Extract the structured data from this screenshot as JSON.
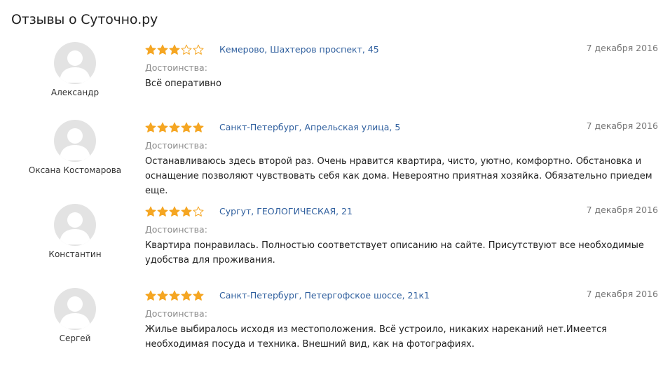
{
  "page": {
    "title": "Отзывы о Суточно.ру"
  },
  "colors": {
    "star_filled": "#f5a623",
    "star_empty": "#f5a623",
    "link": "#2f5f9e",
    "avatar_bg": "#e3e3e3",
    "avatar_fg": "#ffffff"
  },
  "reviews": [
    {
      "author": "Александр",
      "rating": 3,
      "location": "Кемерово, Шахтеров проспект, 45",
      "date": "7 декабря 2016",
      "pros_label": "Достоинства:",
      "text": "Всё оперативно"
    },
    {
      "author": "Оксана Костомарова",
      "rating": 5,
      "location": "Санкт-Петербург, Апрельская улица, 5",
      "date": "7 декабря 2016",
      "pros_label": "Достоинства:",
      "text": "Останавливаюсь здесь второй раз. Очень нравится квартира, чисто, уютно, комфортно. Обстановка и оснащение позволяют чувствовать себя как дома. Невероятно приятная хозяйка. Обязательно приедем еще."
    },
    {
      "author": "Константин",
      "rating": 4,
      "location": "Сургут, ГЕОЛОГИЧЕСКАЯ, 21",
      "date": "7 декабря 2016",
      "pros_label": "Достоинства:",
      "text": "Квартира понравилась. Полностью соответствует описанию на сайте. Присутствуют все необходимые удобства для проживания."
    },
    {
      "author": "Сергей",
      "rating": 5,
      "location": "Санкт-Петербург, Петергофское шоссе, 21к1",
      "date": "7 декабря 2016",
      "pros_label": "Достоинства:",
      "text": "Жилье выбиралось исходя из местоположения. Всё устроило, никаких нареканий нет.Имеется необходимая посуда и техника. Внешний вид, как на фотографиях."
    }
  ]
}
